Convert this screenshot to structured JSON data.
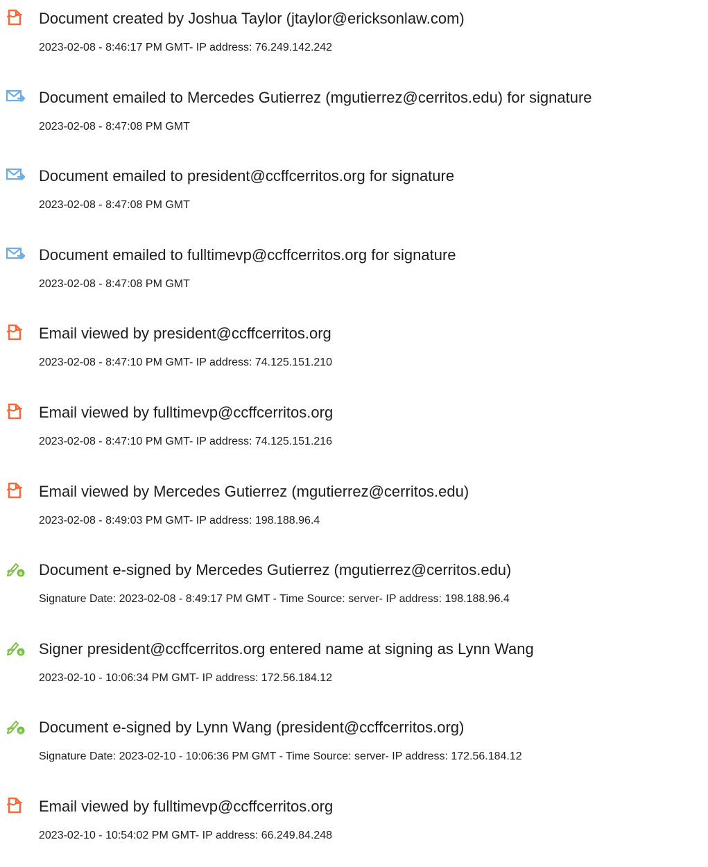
{
  "colors": {
    "doc_icon": "#f26b3a",
    "email_icon": "#6aaee8",
    "sign_icon": "#7ac143",
    "text": "#1d1d1d"
  },
  "events": [
    {
      "icon": "document-icon",
      "title": "Document created by Joshua Taylor (jtaylor@ericksonlaw.com)",
      "detail": "2023-02-08 - 8:46:17 PM GMT- IP address: 76.249.142.242"
    },
    {
      "icon": "email-sent-icon",
      "title": "Document emailed to Mercedes Gutierrez (mgutierrez@cerritos.edu) for signature",
      "detail": "2023-02-08 - 8:47:08 PM GMT"
    },
    {
      "icon": "email-sent-icon",
      "title": "Document emailed to president@ccffcerritos.org for signature",
      "detail": "2023-02-08 - 8:47:08 PM GMT"
    },
    {
      "icon": "email-sent-icon",
      "title": "Document emailed to fulltimevp@ccffcerritos.org for signature",
      "detail": "2023-02-08 - 8:47:08 PM GMT"
    },
    {
      "icon": "document-icon",
      "title": "Email viewed by president@ccffcerritos.org",
      "detail": "2023-02-08 - 8:47:10 PM GMT- IP address: 74.125.151.210"
    },
    {
      "icon": "document-icon",
      "title": "Email viewed by fulltimevp@ccffcerritos.org",
      "detail": "2023-02-08 - 8:47:10 PM GMT- IP address: 74.125.151.216"
    },
    {
      "icon": "document-icon",
      "title": "Email viewed by Mercedes Gutierrez (mgutierrez@cerritos.edu)",
      "detail": "2023-02-08 - 8:49:03 PM GMT- IP address: 198.188.96.4"
    },
    {
      "icon": "esign-icon",
      "title": "Document e-signed by Mercedes Gutierrez (mgutierrez@cerritos.edu)",
      "detail": "Signature Date: 2023-02-08 - 8:49:17 PM GMT - Time Source: server- IP address: 198.188.96.4"
    },
    {
      "icon": "esign-icon",
      "title": "Signer president@ccffcerritos.org entered name at signing as Lynn Wang",
      "detail": "2023-02-10 - 10:06:34 PM GMT- IP address: 172.56.184.12"
    },
    {
      "icon": "esign-icon",
      "title": "Document e-signed by Lynn Wang (president@ccffcerritos.org)",
      "detail": "Signature Date: 2023-02-10 - 10:06:36 PM GMT - Time Source: server- IP address: 172.56.184.12"
    },
    {
      "icon": "document-icon",
      "title": "Email viewed by fulltimevp@ccffcerritos.org",
      "detail": "2023-02-10 - 10:54:02 PM GMT- IP address: 66.249.84.248"
    }
  ]
}
